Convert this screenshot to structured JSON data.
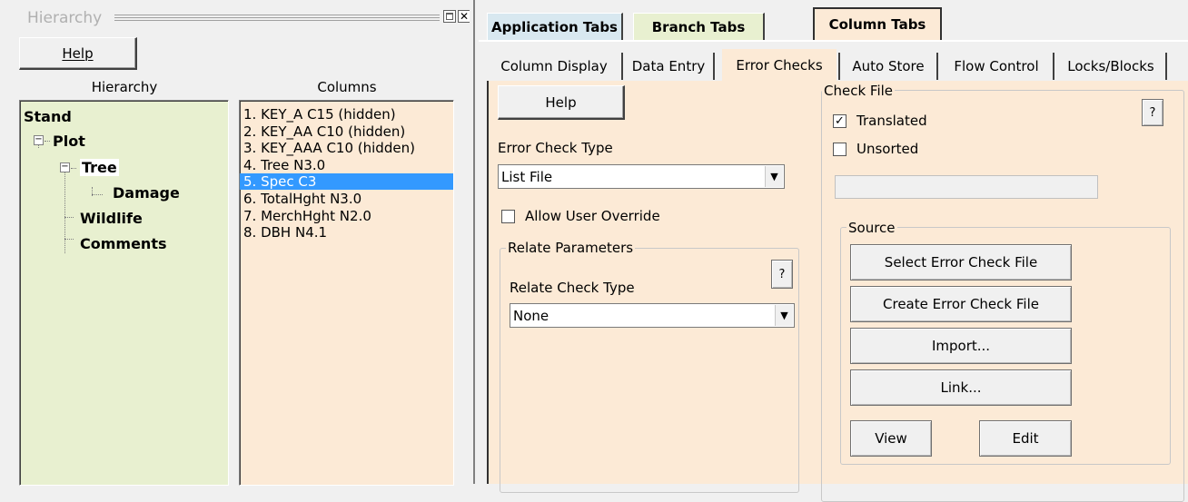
{
  "hierarchy_window": {
    "title": "Hierarchy",
    "help_button": "Help",
    "hierarchy_label": "Hierarchy",
    "columns_label": "Columns",
    "tree": {
      "stand": "Stand",
      "plot": "Plot",
      "tree": "Tree",
      "damage": "Damage",
      "wildlife": "Wildlife",
      "comments": "Comments"
    },
    "columns": [
      "1. KEY_A C15 (hidden)",
      "2. KEY_AA C10 (hidden)",
      "3. KEY_AAA C10 (hidden)",
      "4. Tree N3.0",
      "5. Spec C3",
      "6. TotalHght N3.0",
      "7. MerchHght N2.0",
      "8. DBH N4.1"
    ],
    "selected_column_index": 4
  },
  "main_tabs": {
    "application": "Application Tabs",
    "branch": "Branch Tabs",
    "column": "Column Tabs"
  },
  "sub_tabs": {
    "column_display": "Column Display",
    "data_entry": "Data Entry",
    "error_checks": "Error Checks",
    "auto_store": "Auto Store",
    "flow_control": "Flow Control",
    "locks_blocks": "Locks/Blocks"
  },
  "error_checks": {
    "help_button": "Help",
    "error_check_type_label": "Error Check Type",
    "error_check_type_value": "List File",
    "allow_user_override_label": "Allow User Override",
    "allow_user_override_checked": false,
    "relate_parameters": {
      "title": "Relate Parameters",
      "help": "?",
      "relate_check_type_label": "Relate Check Type",
      "relate_check_type_value": "None"
    },
    "check_file": {
      "title": "Check File",
      "help": "?",
      "translated_label": "Translated",
      "translated_checked": true,
      "unsorted_label": "Unsorted",
      "unsorted_checked": false,
      "file_path_value": "",
      "source": {
        "title": "Source",
        "select_button": "Select Error Check File",
        "create_button": "Create Error Check File",
        "import_button": "Import...",
        "link_button": "Link...",
        "view_button": "View",
        "edit_button": "Edit"
      }
    }
  },
  "colors": {
    "tree_panel_bg": "#e8f0d0",
    "columns_panel_bg": "#fcead6",
    "tab_content_bg": "#fcead6",
    "selection": "#3399ff"
  }
}
